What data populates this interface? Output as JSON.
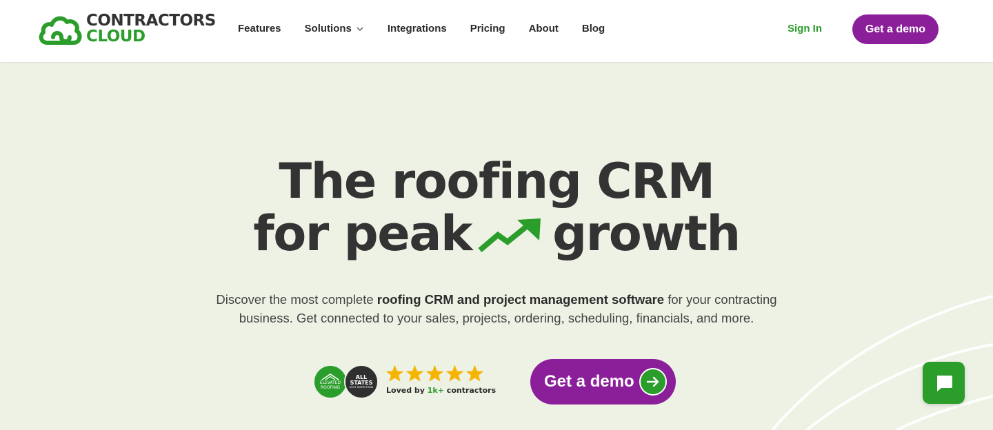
{
  "brand": {
    "line1": "CONTRACTORS",
    "line2": "CLOUD",
    "primary_color": "#2a9d2a",
    "accent_color": "#8b1f9a"
  },
  "nav": {
    "items": [
      {
        "label": "Features"
      },
      {
        "label": "Solutions",
        "has_dropdown": true
      },
      {
        "label": "Integrations"
      },
      {
        "label": "Pricing"
      },
      {
        "label": "About"
      },
      {
        "label": "Blog"
      }
    ],
    "sign_in": "Sign In",
    "demo_button": "Get a demo"
  },
  "hero": {
    "title_line1": "The roofing CRM",
    "title_line2_part1": "for peak",
    "title_line2_part2": "growth",
    "title_icon": "trending-up-arrow-icon",
    "subtitle_part1": "Discover the most complete ",
    "subtitle_bold": "roofing CRM and project management software",
    "subtitle_part2": " for your contracting business. Get connected to your sales, projects, ordering, scheduling, financials, and more."
  },
  "social_proof": {
    "badges": [
      {
        "line1": "ELEVATED",
        "line2": "ROOFING"
      },
      {
        "line1": "ALL",
        "line2": "STATES",
        "line3": "ROOF INSPECTIONS"
      }
    ],
    "star_count": 5,
    "star_color": "#f5b400",
    "loved_prefix": "Loved by ",
    "loved_highlight": "1k+",
    "loved_suffix": " contractors"
  },
  "cta": {
    "label": "Get a demo",
    "icon": "arrow-right-icon"
  },
  "chat_widget": {
    "icon": "chat-bubble-icon"
  }
}
